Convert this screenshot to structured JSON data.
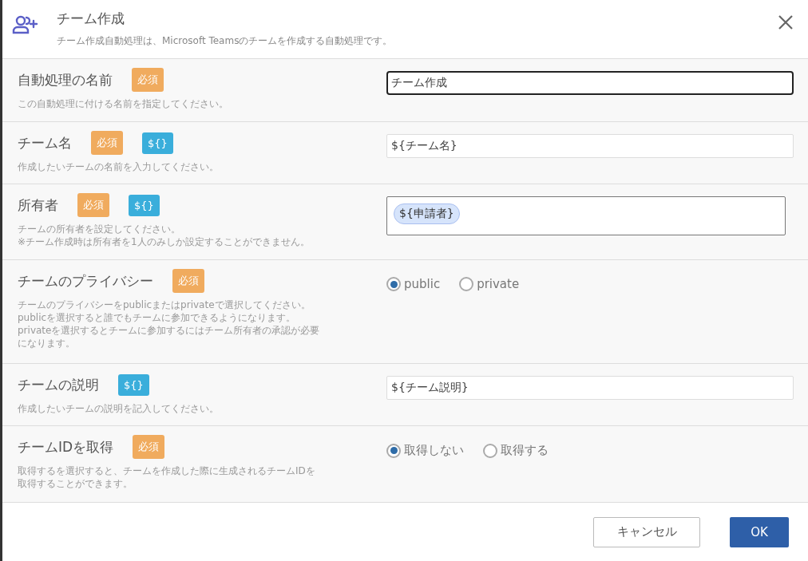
{
  "dialog": {
    "title": "チーム作成",
    "subtitle": "チーム作成自動処理は、Microsoft Teamsのチームを作成する自動処理です。"
  },
  "rows": [
    {
      "label": "自動処理の名前",
      "badges": [
        {
          "kind": "required",
          "text": "必須"
        }
      ],
      "description": [
        "この自動処理に付ける名前を指定してください。"
      ],
      "field": {
        "kind": "text",
        "value": "チーム作成",
        "focused": true
      }
    },
    {
      "label": "チーム名",
      "badges": [
        {
          "kind": "required",
          "text": "必須"
        },
        {
          "kind": "variable",
          "text": "${}"
        }
      ],
      "description": [
        "作成したいチームの名前を入力してください。"
      ],
      "field": {
        "kind": "text",
        "value": "${チーム名}",
        "focused": false
      }
    },
    {
      "label": "所有者",
      "badges": [
        {
          "kind": "required",
          "text": "必須"
        },
        {
          "kind": "variable",
          "text": "${}"
        }
      ],
      "description": [
        "チームの所有者を設定してください。",
        "※チーム作成時は所有者を1人のみしか設定することができません。"
      ],
      "field": {
        "kind": "chips",
        "chips": [
          "${申請者}"
        ]
      }
    },
    {
      "label": "チームのプライバシー",
      "badges": [
        {
          "kind": "required",
          "text": "必須"
        }
      ],
      "description": [
        "チームのプライバシーをpublicまたはprivateで選択してください。",
        "publicを選択すると誰でもチームに参加できるようになります。",
        "privateを選択するとチームに参加するにはチーム所有者の承認が必要",
        "になります。"
      ],
      "field": {
        "kind": "radio",
        "options": [
          {
            "label": "public",
            "selected": true
          },
          {
            "label": "private",
            "selected": false
          }
        ]
      }
    },
    {
      "label": "チームの説明",
      "badges": [
        {
          "kind": "variable",
          "text": "${}"
        }
      ],
      "description": [
        "作成したいチームの説明を記入してください。"
      ],
      "field": {
        "kind": "text",
        "value": "${チーム説明}",
        "focused": false
      }
    },
    {
      "label": "チームIDを取得",
      "badges": [
        {
          "kind": "required",
          "text": "必須"
        }
      ],
      "description": [
        "取得するを選択すると、チームを作成した際に生成されるチームIDを",
        "取得することができます。"
      ],
      "field": {
        "kind": "radio",
        "options": [
          {
            "label": "取得しない",
            "selected": true
          },
          {
            "label": "取得する",
            "selected": false
          }
        ]
      }
    }
  ],
  "buttons": [
    {
      "kind": "secondary",
      "label": "キャンセル"
    },
    {
      "kind": "primary",
      "label": "OK"
    }
  ]
}
